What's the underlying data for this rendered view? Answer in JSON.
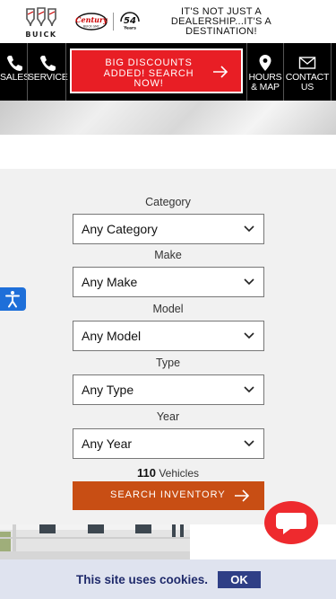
{
  "header": {
    "brand_name": "BUICK",
    "dealer_logo_text": "Century",
    "dealer_logo_subtext": "BUICK GMC",
    "years_number": "54",
    "years_label": "Years",
    "tagline": "IT'S NOT JUST A DEALERSHIP...IT'S A DESTINATION!"
  },
  "nav": {
    "sales_label": "SALES",
    "service_label": "SERVICE",
    "promo_label": "BIG DISCOUNTS ADDED! SEARCH NOW!",
    "hours_label": "HOURS & MAP",
    "contact_label": "CONTACT US"
  },
  "search": {
    "fields": [
      {
        "label": "Category",
        "value": "Any Category"
      },
      {
        "label": "Make",
        "value": "Any Make"
      },
      {
        "label": "Model",
        "value": "Any Model"
      },
      {
        "label": "Type",
        "value": "Any Type"
      },
      {
        "label": "Year",
        "value": "Any Year"
      }
    ],
    "vehicle_count": "110",
    "vehicle_count_label": "Vehicles",
    "button_label": "SEARCH INVENTORY"
  },
  "cookie": {
    "message": "This site uses cookies.",
    "ok_label": "OK"
  },
  "colors": {
    "promo_red": "#e81e25",
    "search_button_orange": "#c84e14",
    "chat_red": "#ee2a2e",
    "accessibility_blue": "#1e6fd9",
    "cookie_navy": "#2f3f86"
  },
  "icons": {
    "sales": "phone-icon",
    "service": "phone-icon",
    "promo": "arrow-right-icon",
    "hours": "map-pin-icon",
    "contact": "envelope-icon",
    "select": "chevron-down-icon",
    "accessibility": "accessibility-icon",
    "chat": "chat-bubble-icon"
  }
}
